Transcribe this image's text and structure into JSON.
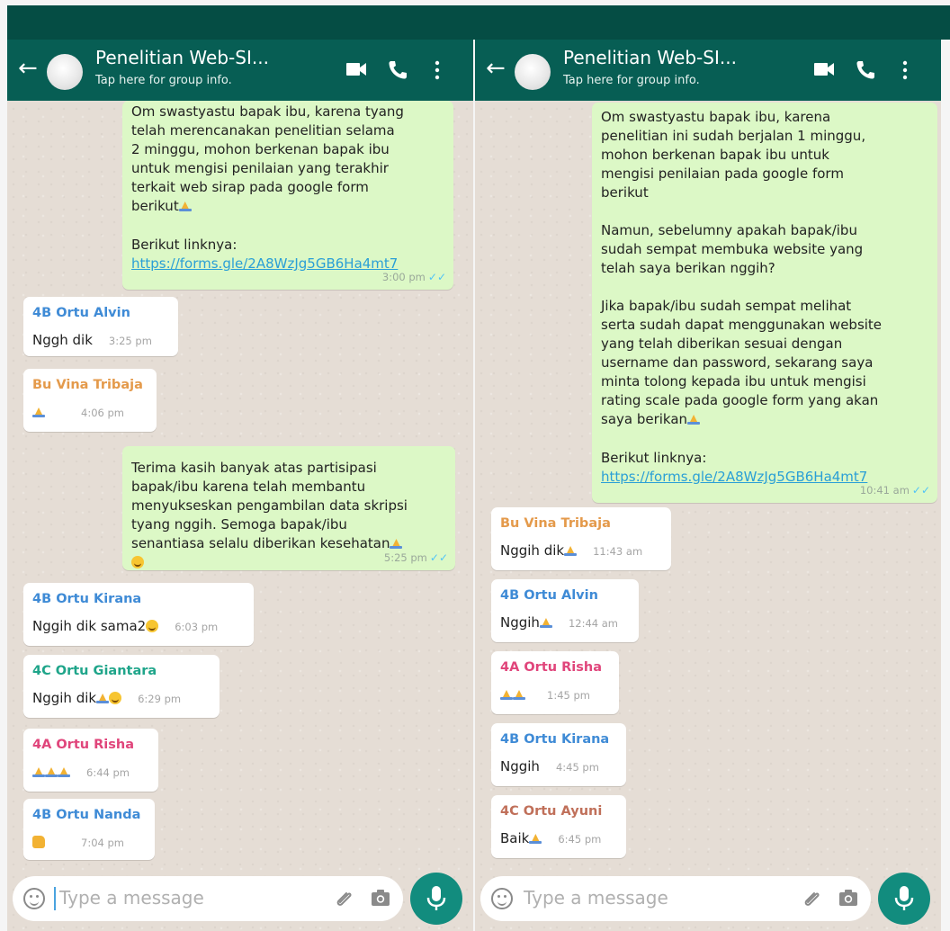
{
  "panels": [
    {
      "id": "left",
      "header": {
        "title": "Penelitian Web-SI...",
        "subtitle": "Tap here for group info."
      },
      "messages": [
        {
          "type": "out",
          "text": "Om swastyastu bapak ibu, karena tyang\ntelah merencanakan penelitian selama\n2 minggu, mohon berkenan bapak ibu\nuntuk mengisi penilaian yang terakhir\nterkait web sirap pada google form\nberikut",
          "link_label": "Berikut linknya:",
          "link": "https://forms.gle/2A8WzJg5GB6Ha4mt7",
          "time": "3:00 pm"
        },
        {
          "type": "in",
          "sender": "4B Ortu Alvin",
          "sender_color": "#3f8bd6",
          "text": "Nggh dik",
          "time": "3:25 pm"
        },
        {
          "type": "in",
          "sender": "Bu Vina Tribaja",
          "sender_color": "#e49a4b",
          "text": "",
          "time": "4:06 pm"
        },
        {
          "type": "out",
          "text": "Terima kasih banyak atas partisipasi\nbapak/ibu karena telah membantu\nmenyukseskan pengambilan data skripsi\ntyang nggih. Semoga bapak/ibu\nsenantiasa selalu diberikan kesehatan",
          "time": "5:25 pm"
        },
        {
          "type": "in",
          "sender": "4B Ortu Kirana",
          "sender_color": "#3f8bd6",
          "text": "Nggih dik sama2",
          "time": "6:03 pm"
        },
        {
          "type": "in",
          "sender": "4C Ortu Giantara",
          "sender_color": "#1fa58a",
          "text": "Nggih dik",
          "time": "6:29 pm"
        },
        {
          "type": "in",
          "sender": "4A Ortu Risha",
          "sender_color": "#e0457b",
          "text": "",
          "time": "6:44 pm"
        },
        {
          "type": "in",
          "sender": "4B Ortu Nanda",
          "sender_color": "#3f8bd6",
          "text": "",
          "time": "7:04 pm"
        }
      ],
      "input": {
        "placeholder": "Type a message"
      }
    },
    {
      "id": "right",
      "header": {
        "title": "Penelitian Web-SI...",
        "subtitle": "Tap here for group info."
      },
      "messages": [
        {
          "type": "out",
          "text": "Om swastyastu bapak ibu, karena\npenelitian ini sudah berjalan 1 minggu,\nmohon berkenan bapak ibu untuk\nmengisi penilaian pada google form\nberikut\n\nNamun, sebelumny apakah bapak/ibu\nsudah sempat membuka website yang\ntelah saya berikan nggih?\n\nJika bapak/ibu sudah sempat melihat\nserta sudah dapat menggunakan website\nyang telah diberikan sesuai dengan\nusername dan password, sekarang saya\nminta tolong kepada ibu untuk mengisi\nrating scale pada google form yang akan\nsaya berikan",
          "link_label": "Berikut linknya:",
          "link": "https://forms.gle/2A8WzJg5GB6Ha4mt7",
          "time": "10:41 am"
        },
        {
          "type": "in",
          "sender": "Bu Vina Tribaja",
          "sender_color": "#e49a4b",
          "text": "Nggih dik",
          "time": "11:43 am"
        },
        {
          "type": "in",
          "sender": "4B Ortu Alvin",
          "sender_color": "#3f8bd6",
          "text": "Nggih",
          "time": "12:44 am"
        },
        {
          "type": "in",
          "sender": "4A Ortu Risha",
          "sender_color": "#e0457b",
          "text": "",
          "time": "1:45 pm"
        },
        {
          "type": "in",
          "sender": "4B Ortu Kirana",
          "sender_color": "#3f8bd6",
          "text": "Nggih",
          "time": "4:45 pm"
        },
        {
          "type": "in",
          "sender": "4C Ortu Ayuni",
          "sender_color": "#c0705a",
          "text": "Baik",
          "time": "6:45 pm"
        }
      ],
      "input": {
        "placeholder": "Type a message"
      }
    }
  ],
  "colors": {
    "header": "#075e54",
    "status_bar": "#054d44",
    "outgoing_bubble": "#dcf8c6",
    "incoming_bubble": "#ffffff",
    "mic_button": "#128c7e",
    "link": "#2a9fd6",
    "read_tick": "#4fc3f7"
  },
  "icons": [
    "back-arrow-icon",
    "group-avatar-icon",
    "video-call-icon",
    "voice-call-icon",
    "more-options-icon",
    "emoji-icon",
    "attach-icon",
    "camera-icon",
    "mic-icon",
    "folded-hands-emoji",
    "smiling-face-emoji",
    "thumbs-up-emoji"
  ]
}
